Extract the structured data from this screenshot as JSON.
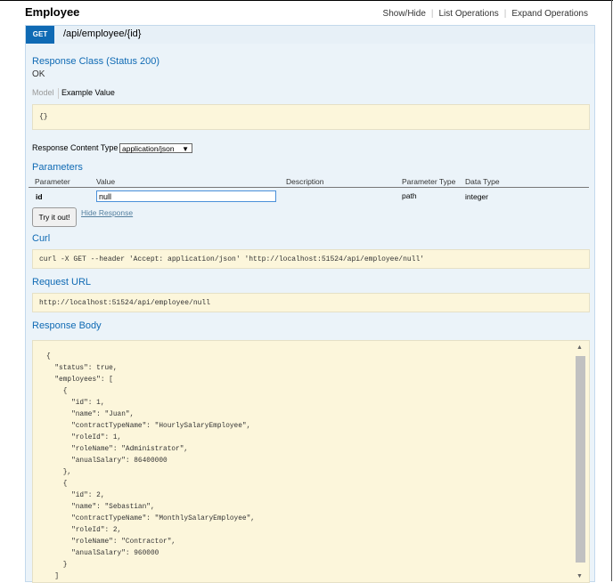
{
  "header": {
    "title": "Employee",
    "show_hide": "Show/Hide",
    "list_operations": "List Operations",
    "expand_operations": "Expand Operations"
  },
  "operation": {
    "method": "GET",
    "path": "/api/employee/{id}"
  },
  "response_class": {
    "heading": "Response Class (Status 200)",
    "status_text": "OK",
    "tab_model": "Model",
    "tab_example": "Example Value",
    "example_value": "{}"
  },
  "content_type": {
    "label": "Response Content Type",
    "value": "application/json"
  },
  "parameters": {
    "heading": "Parameters",
    "columns": [
      "Parameter",
      "Value",
      "Description",
      "Parameter Type",
      "Data Type"
    ],
    "row": {
      "name": "id",
      "value": "null",
      "description": "",
      "param_type": "path",
      "data_type": "integer"
    }
  },
  "actions": {
    "try_button": "Try it out!",
    "hide_response": "Hide Response"
  },
  "curl": {
    "heading": "Curl",
    "command": "curl -X GET --header 'Accept: application/json' 'http://localhost:51524/api/employee/null'"
  },
  "request_url": {
    "heading": "Request URL",
    "url": "http://localhost:51524/api/employee/null"
  },
  "response_body": {
    "heading": "Response Body",
    "json": "{\n  \"status\": true,\n  \"employees\": [\n    {\n      \"id\": 1,\n      \"name\": \"Juan\",\n      \"contractTypeName\": \"HourlySalaryEmployee\",\n      \"roleId\": 1,\n      \"roleName\": \"Administrator\",\n      \"anualSalary\": 86400000\n    },\n    {\n      \"id\": 2,\n      \"name\": \"Sebastian\",\n      \"contractTypeName\": \"MonthlySalaryEmployee\",\n      \"roleId\": 2,\n      \"roleName\": \"Contractor\",\n      \"anualSalary\": 960000\n    }\n  ]"
  },
  "colors": {
    "method_bg": "#0f6ab4",
    "heading": "#0f6ab4",
    "panel_bg": "#ebf3f9",
    "snippet_bg": "#fcf6db",
    "link": "#547f9e"
  }
}
